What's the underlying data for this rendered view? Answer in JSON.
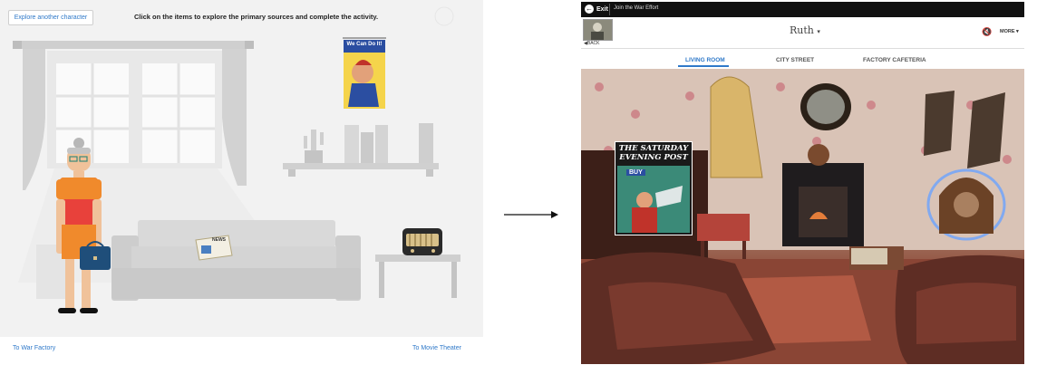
{
  "left_panel": {
    "explore_button": "Explore another character",
    "instruction": "Click on the items to explore the primary sources and complete the activity.",
    "poster_text": "We Can Do It!",
    "newspaper_label": "NEWS",
    "footer": {
      "left_link": "To War Factory",
      "right_link": "To Movie Theater"
    }
  },
  "right_panel": {
    "topbar": {
      "exit_label": "Exit",
      "join_label": "Join the War Effort"
    },
    "header": {
      "character_name": "Ruth",
      "back_label": "BACK",
      "more_label": "MORE"
    },
    "tabs": [
      {
        "label": "LIVING ROOM",
        "active": true
      },
      {
        "label": "CITY STREET",
        "active": false
      },
      {
        "label": "FACTORY CAFETERIA",
        "active": false
      }
    ],
    "magazine_title": "THE SATURDAY EVENING POST",
    "magazine_sub": "BUY"
  },
  "colors": {
    "accent": "#2f79c9",
    "topbar": "#111111"
  }
}
